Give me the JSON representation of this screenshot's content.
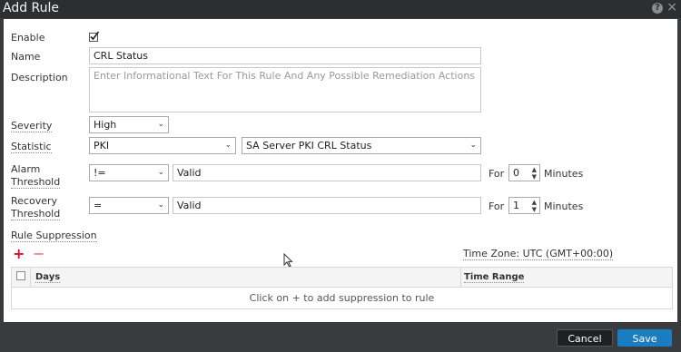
{
  "window": {
    "title": "Add Rule",
    "help_icon": "?",
    "close_icon": "×"
  },
  "form": {
    "enable_label": "Enable",
    "enable_checked": true,
    "name_label": "Name",
    "name_value": "CRL Status",
    "description_label": "Description",
    "description_placeholder": "Enter Informational Text For This Rule And Any Possible Remediation Actions",
    "severity_label": "Severity",
    "severity_value": "High",
    "statistic_label": "Statistic",
    "statistic_category": "PKI",
    "statistic_value": "SA Server PKI CRL Status",
    "alarm_label_line1": "Alarm",
    "alarm_label_line2": "Threshold",
    "alarm_operator": "!=",
    "alarm_value": "Valid",
    "alarm_for_label": "For",
    "alarm_for_value": "0",
    "alarm_minutes_label": "Minutes",
    "recovery_label_line1": "Recovery",
    "recovery_label_line2": "Threshold",
    "recovery_operator": "=",
    "recovery_value": "Valid",
    "recovery_for_label": "For",
    "recovery_for_value": "1",
    "recovery_minutes_label": "Minutes"
  },
  "suppression": {
    "label": "Rule Suppression",
    "add_icon": "+",
    "remove_icon": "−",
    "timezone": "Time Zone: UTC (GMT+00:00)",
    "columns": [
      "Days",
      "Time Range"
    ],
    "empty_message": "Click on + to add suppression to rule"
  },
  "footer": {
    "cancel_label": "Cancel",
    "save_label": "Save"
  },
  "colors": {
    "accent": "#1a7cc1",
    "titlebar": "#2d2e32",
    "add_icon": "#d0142c"
  }
}
